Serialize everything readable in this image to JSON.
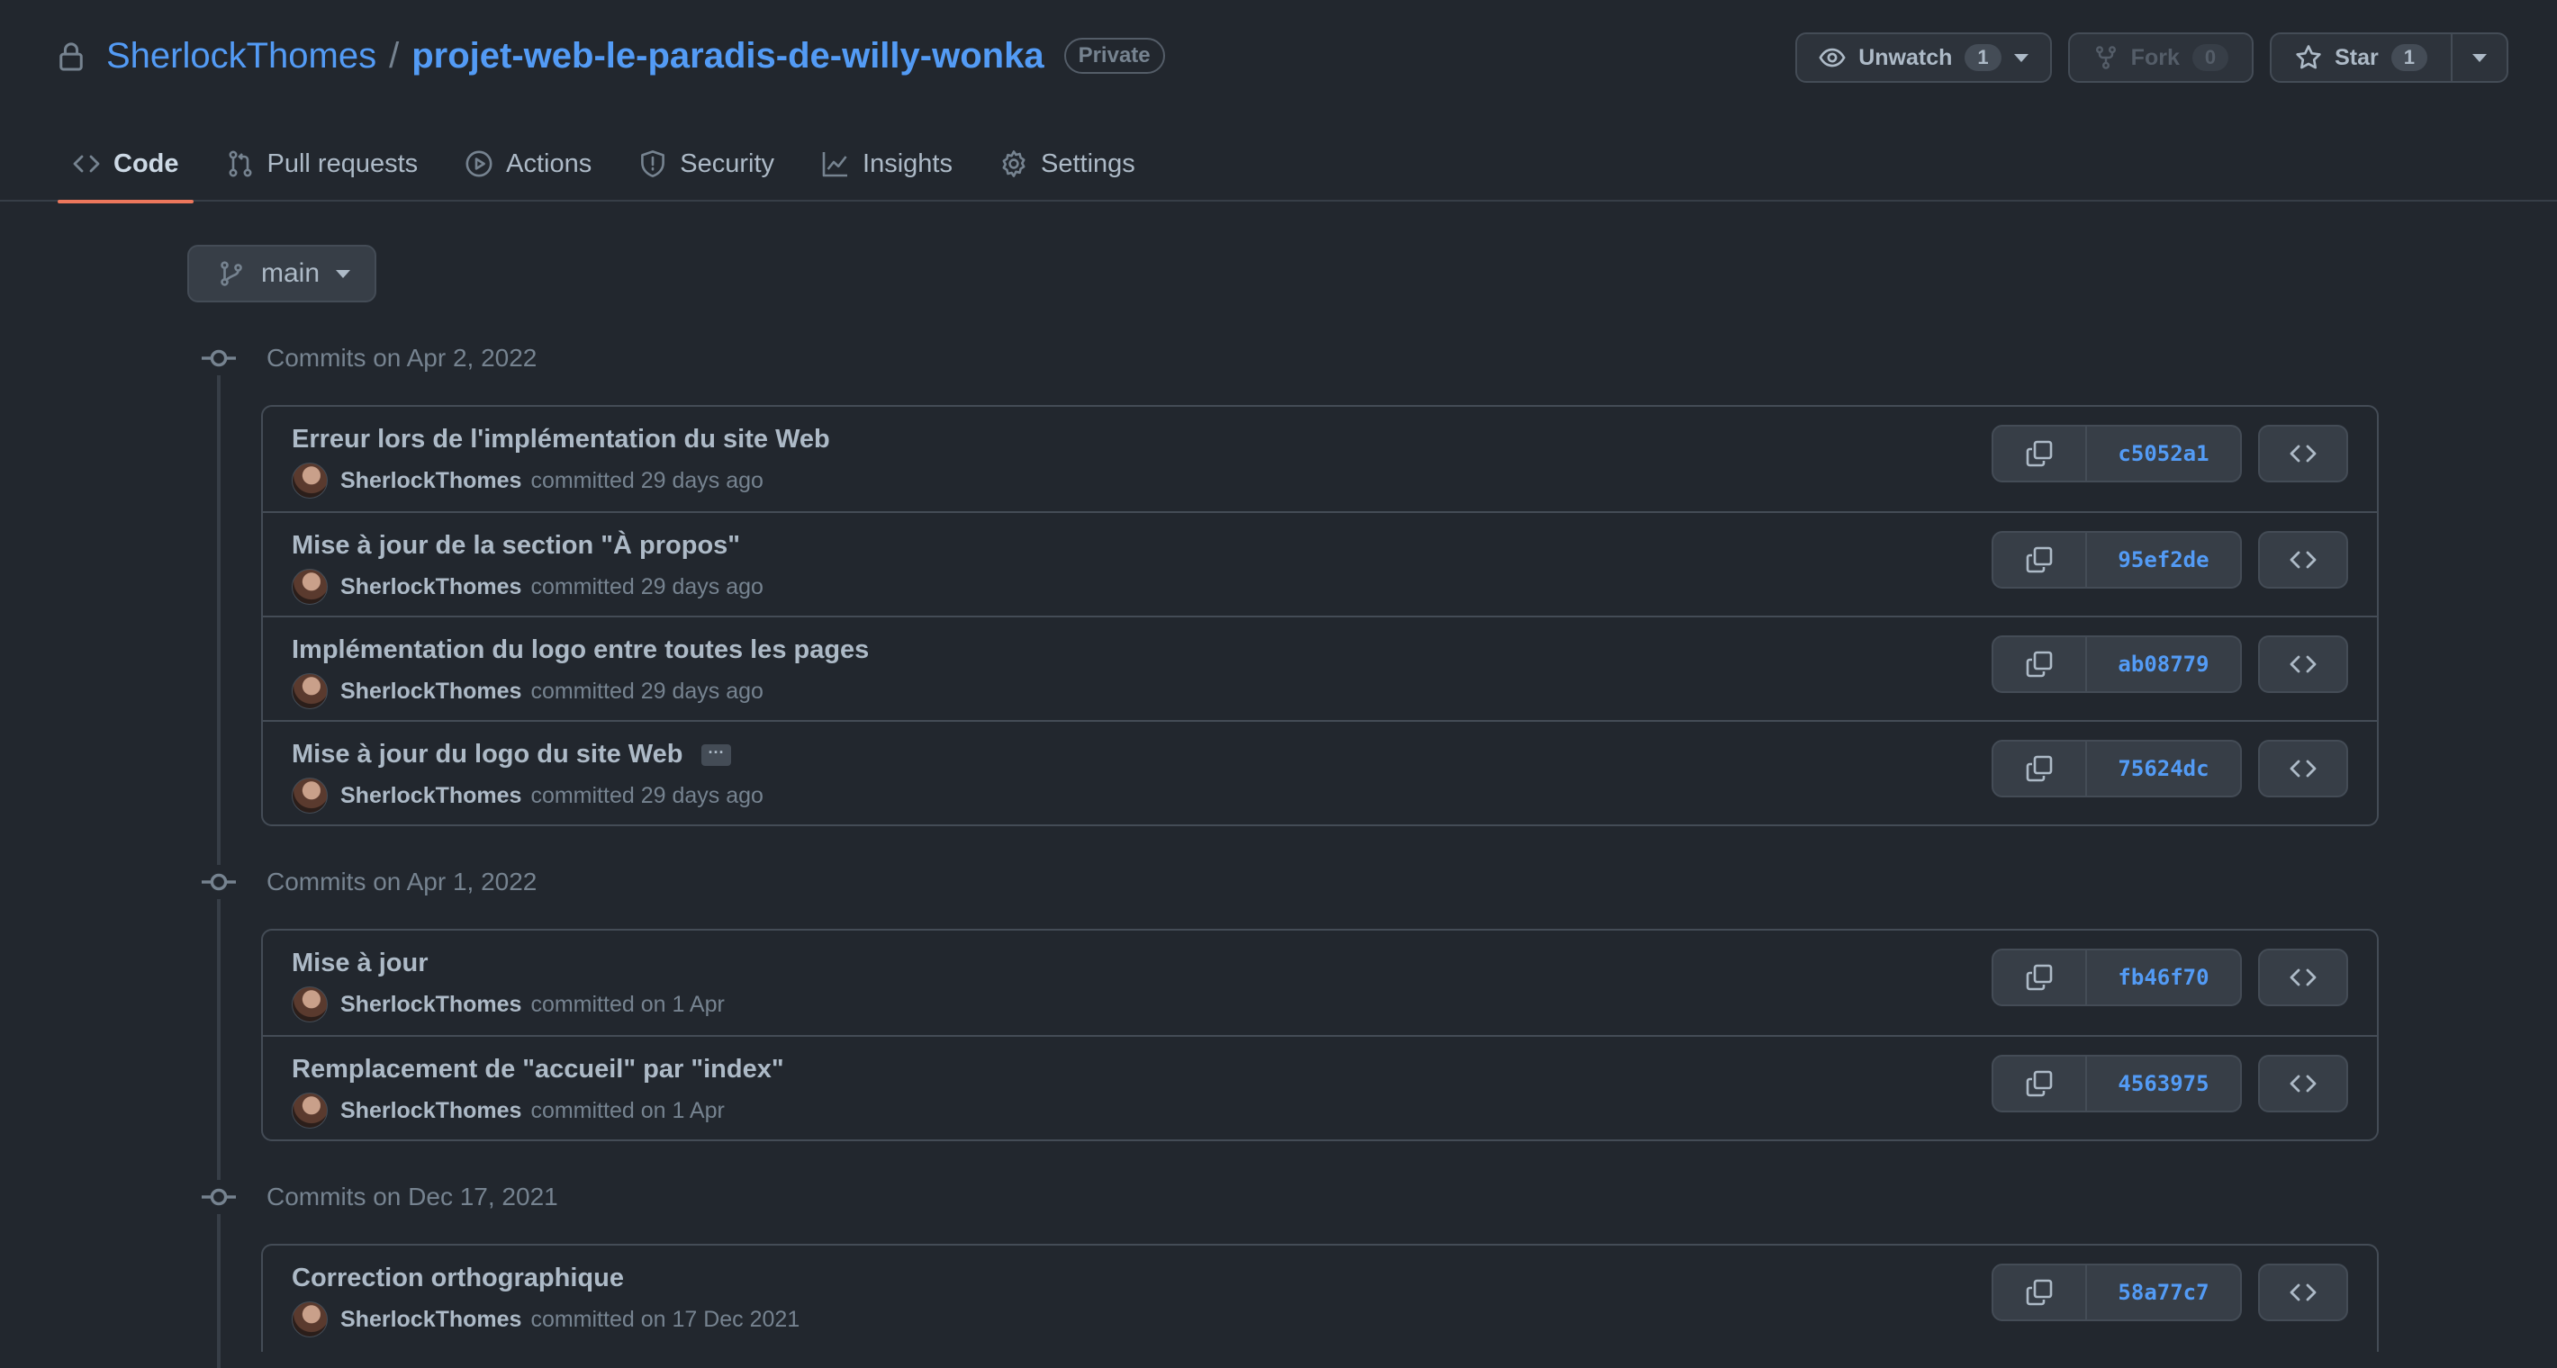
{
  "repo": {
    "owner": "SherlockThomes",
    "separator": "/",
    "name": "projet-web-le-paradis-de-willy-wonka",
    "visibility": "Private"
  },
  "actions": {
    "watch": {
      "label": "Unwatch",
      "count": "1"
    },
    "fork": {
      "label": "Fork",
      "count": "0"
    },
    "star": {
      "label": "Star",
      "count": "1"
    }
  },
  "nav": {
    "tabs": [
      {
        "label": "Code",
        "icon": "code-icon",
        "selected": true
      },
      {
        "label": "Pull requests",
        "icon": "git-pull-request-icon"
      },
      {
        "label": "Actions",
        "icon": "play-icon"
      },
      {
        "label": "Security",
        "icon": "shield-icon"
      },
      {
        "label": "Insights",
        "icon": "graph-icon"
      },
      {
        "label": "Settings",
        "icon": "gear-icon"
      }
    ]
  },
  "branch": {
    "name": "main"
  },
  "groups": [
    {
      "heading": "Commits on Apr 2, 2022",
      "commits": [
        {
          "title": "Erreur lors de l'implémentation du site Web",
          "author": "SherlockThomes",
          "meta": "committed 29 days ago",
          "sha": "c5052a1"
        },
        {
          "title": "Mise à jour de la section \"À propos\"",
          "author": "SherlockThomes",
          "meta": "committed 29 days ago",
          "sha": "95ef2de"
        },
        {
          "title": "Implémentation du logo entre toutes les pages",
          "author": "SherlockThomes",
          "meta": "committed 29 days ago",
          "sha": "ab08779"
        },
        {
          "title": "Mise à jour du logo du site Web",
          "author": "SherlockThomes",
          "meta": "committed 29 days ago",
          "sha": "75624dc",
          "ellipsis": "···"
        }
      ]
    },
    {
      "heading": "Commits on Apr 1, 2022",
      "commits": [
        {
          "title": "Mise à jour",
          "author": "SherlockThomes",
          "meta": "committed on 1 Apr",
          "sha": "fb46f70"
        },
        {
          "title": "Remplacement de \"accueil\" par \"index\"",
          "author": "SherlockThomes",
          "meta": "committed on 1 Apr",
          "sha": "4563975"
        }
      ]
    },
    {
      "heading": "Commits on Dec 17, 2021",
      "commits": [
        {
          "title": "Correction orthographique",
          "author": "SherlockThomes",
          "meta": "committed on 17 Dec 2021",
          "sha": "58a77c7"
        }
      ]
    }
  ]
}
